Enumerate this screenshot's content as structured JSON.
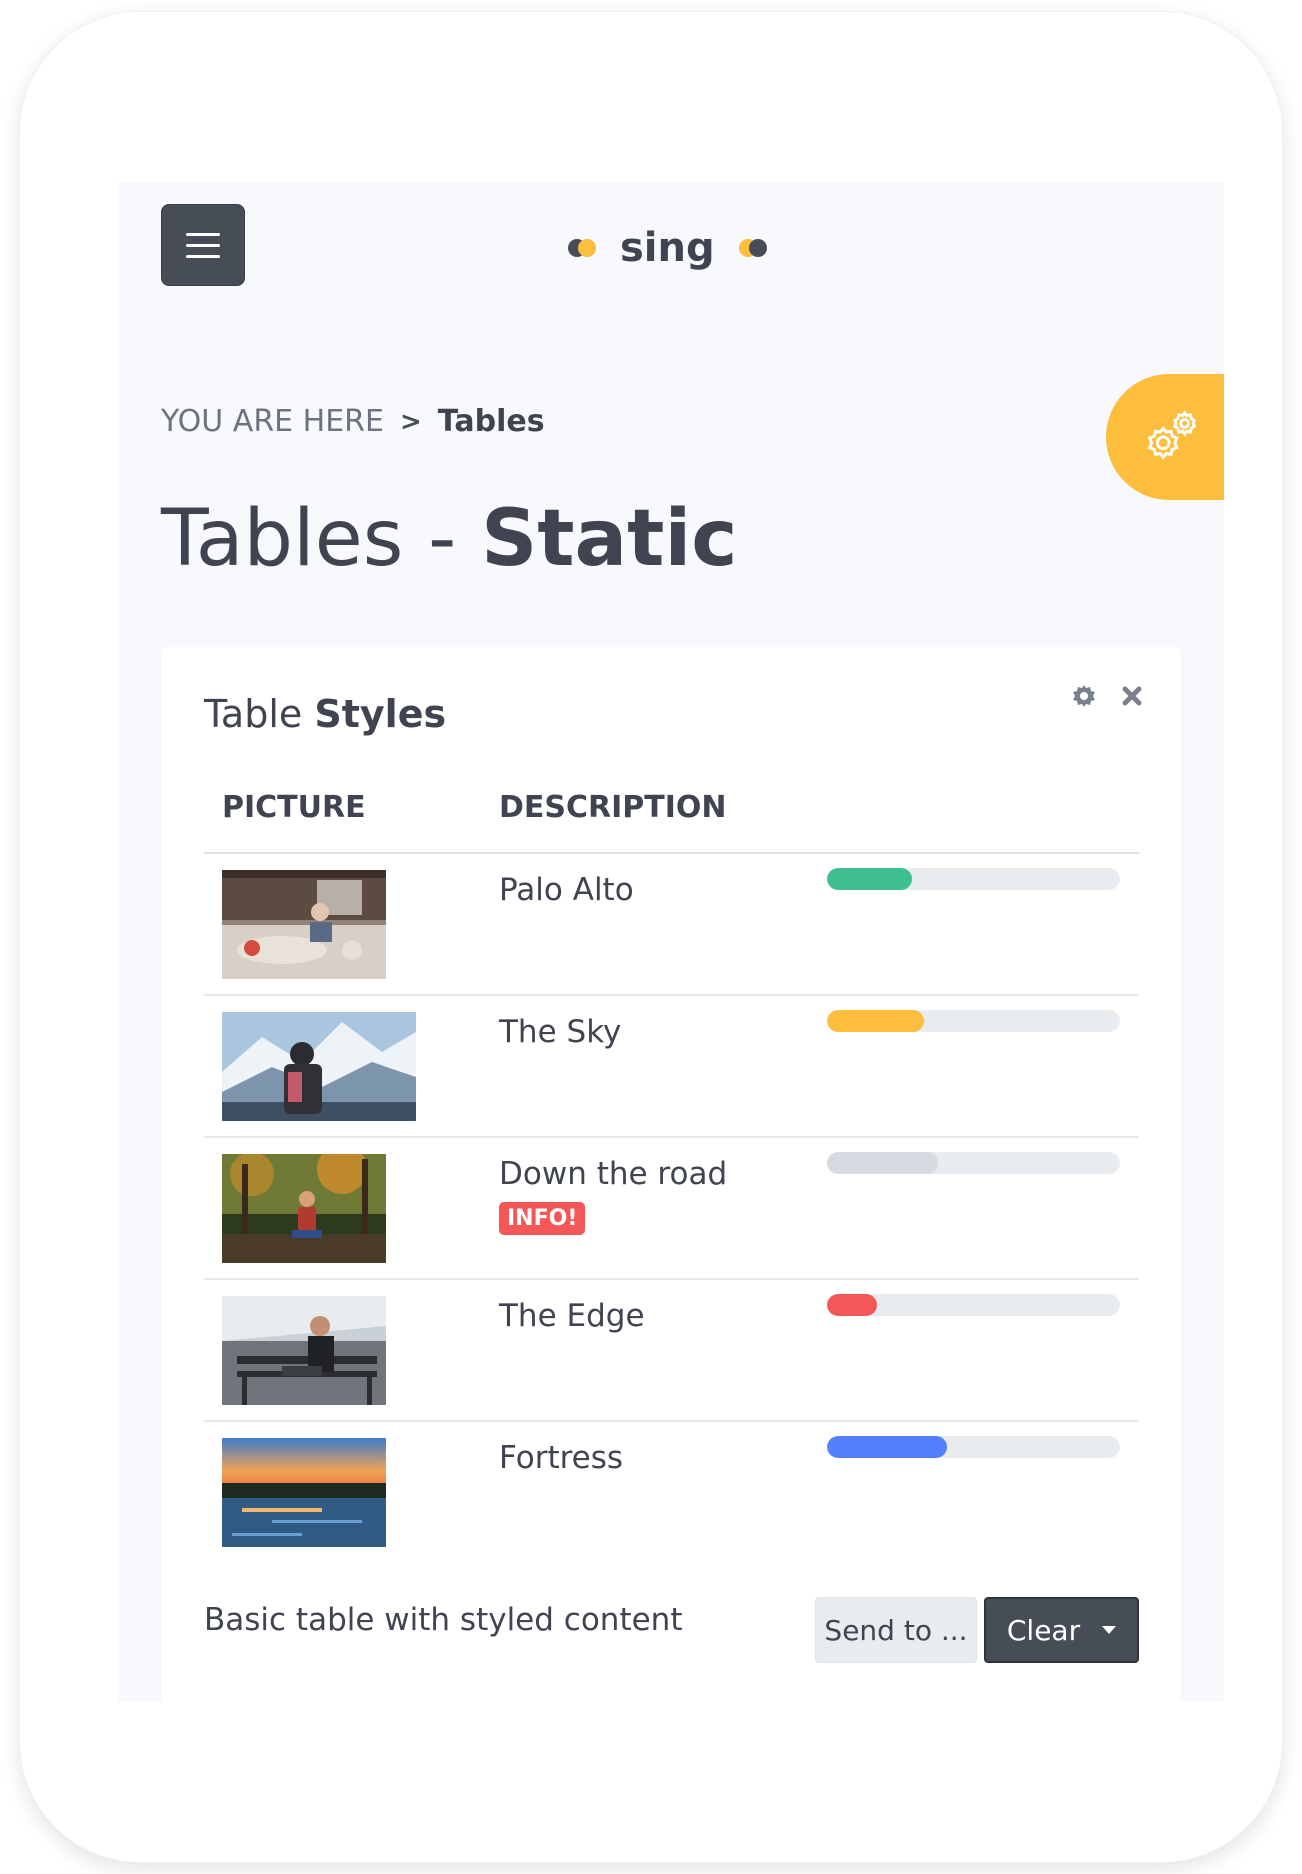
{
  "brand": {
    "name": "sing",
    "accent": "#fdbd3d",
    "dark": "#474d57"
  },
  "header": {
    "menu_icon": "hamburger-icon",
    "settings_icon": "gears-icon"
  },
  "breadcrumb": {
    "prefix": "YOU ARE HERE",
    "separator": ">",
    "current": "Tables"
  },
  "page_title": {
    "main": "Tables - ",
    "bold": "Static"
  },
  "card": {
    "title_light": "Table ",
    "title_bold": "Styles",
    "tools": [
      "gear-icon",
      "close-icon"
    ],
    "columns": [
      "PICTURE",
      "DESCRIPTION"
    ],
    "rows": [
      {
        "description": "Palo Alto",
        "badge": "",
        "progress": 0.29,
        "color": "#3ebf8f",
        "image": "bedroom-photo"
      },
      {
        "description": "The Sky",
        "badge": "",
        "progress": 0.33,
        "color": "#fdbd3d",
        "image": "mountain-hiker-photo"
      },
      {
        "description": "Down the road",
        "badge": "INFO!",
        "progress": 0.38,
        "color": "#d6dbe2",
        "image": "forest-photo"
      },
      {
        "description": "The Edge",
        "badge": "",
        "progress": 0.17,
        "color": "#f45758",
        "image": "bench-man-photo"
      },
      {
        "description": "Fortress",
        "badge": "",
        "progress": 0.41,
        "color": "#547fff",
        "image": "river-sunset-photo"
      }
    ],
    "footer_text": "Basic table with styled content",
    "send_button": "Send to ...",
    "clear_button": "Clear"
  }
}
